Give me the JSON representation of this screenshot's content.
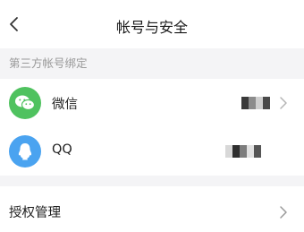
{
  "header": {
    "title": "帐号与安全"
  },
  "section": {
    "label": "第三方帐号绑定"
  },
  "accounts": [
    {
      "label": "微信",
      "icon": "wechat-icon",
      "color": "#4fc25f"
    },
    {
      "label": "QQ",
      "icon": "qq-icon",
      "color": "#4aa3f0"
    }
  ],
  "auth": {
    "label": "授权管理"
  }
}
